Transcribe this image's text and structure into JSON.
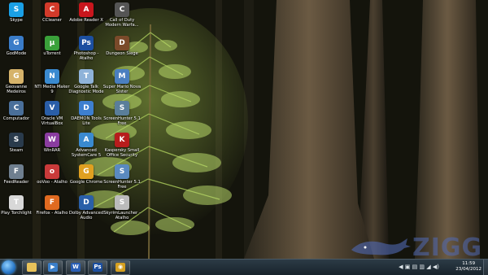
{
  "desktop": {
    "icons": [
      {
        "label": "Skype",
        "color": "#1aa0e6",
        "glyph": "S"
      },
      {
        "label": "CCleaner",
        "color": "#d23a2a",
        "glyph": "C"
      },
      {
        "label": "Adobe Reader X",
        "color": "#c8161d",
        "glyph": "A"
      },
      {
        "label": "Call of Duty Modern Warfa...",
        "color": "#555555",
        "glyph": "C"
      },
      {
        "label": "GodMode",
        "color": "#3a7cc8",
        "glyph": "G"
      },
      {
        "label": "uTorrent",
        "color": "#3aa13a",
        "glyph": "µ"
      },
      {
        "label": "Photoshop - Atalho",
        "color": "#1c4fa0",
        "glyph": "Ps"
      },
      {
        "label": "Dungeon Siege",
        "color": "#7a4a2a",
        "glyph": "D"
      },
      {
        "label": "Geovanne Medeiros",
        "color": "#d6b36a",
        "glyph": "G"
      },
      {
        "label": "NTI Media Maker 9",
        "color": "#3a8ad0",
        "glyph": "N"
      },
      {
        "label": "Google Talk Diagnostic Mode",
        "color": "#8fb3d9",
        "glyph": "T"
      },
      {
        "label": "Super Mario Nova Sister",
        "color": "#4a7fc0",
        "glyph": "M"
      },
      {
        "label": "Computador",
        "color": "#4a6f9a",
        "glyph": "C"
      },
      {
        "label": "Oracle VM VirtualBox",
        "color": "#2a5ea8",
        "glyph": "V"
      },
      {
        "label": "DAEMON Tools Lite",
        "color": "#3e7fd0",
        "glyph": "D"
      },
      {
        "label": "ScreenHunter 5.1 Free",
        "color": "#5a7e9a",
        "glyph": "S"
      },
      {
        "label": "Steam",
        "color": "#2a3b4c",
        "glyph": "S"
      },
      {
        "label": "WinRAR",
        "color": "#8a3ca0",
        "glyph": "W"
      },
      {
        "label": "Advanced SystemCare 5",
        "color": "#3a8ad0",
        "glyph": "A"
      },
      {
        "label": "Kaspersky Small Office Security",
        "color": "#b71c1c",
        "glyph": "K"
      },
      {
        "label": "FeedReader",
        "color": "#6f7f8f",
        "glyph": "F"
      },
      {
        "label": "ooVoo - Atalho",
        "color": "#c93a3a",
        "glyph": "o"
      },
      {
        "label": "Google Chrome",
        "color": "#e0a020",
        "glyph": "G"
      },
      {
        "label": "ScreenHunter 5.1 Free",
        "color": "#5a8ac0",
        "glyph": "S"
      },
      {
        "label": "Play Torchlight",
        "color": "#d8d8d8",
        "glyph": "T"
      },
      {
        "label": "Firefox - Atalho",
        "color": "#e06a20",
        "glyph": "F"
      },
      {
        "label": "Dolby Advanced Audio",
        "color": "#2a5fa8",
        "glyph": "D"
      },
      {
        "label": "SkyrimLauncher - Atalho",
        "color": "#bbbbbb",
        "glyph": "S"
      }
    ]
  },
  "watermark": {
    "text": "ZIGG"
  },
  "taskbar": {
    "pinned": [
      {
        "name": "explorer",
        "color": "#e8c25a",
        "glyph": ""
      },
      {
        "name": "media-player",
        "color": "#3a7ec8",
        "glyph": "▶"
      },
      {
        "name": "word",
        "color": "#2b5fb4",
        "glyph": "W"
      },
      {
        "name": "photoshop",
        "color": "#1c4fa0",
        "glyph": "Ps"
      },
      {
        "name": "chrome",
        "color": "#d6a020",
        "glyph": "◉"
      }
    ],
    "tray_icons": "◀ ▣ ▤ ▥ ◢ ◀)",
    "time": "11:59",
    "date": "23/04/2012"
  }
}
